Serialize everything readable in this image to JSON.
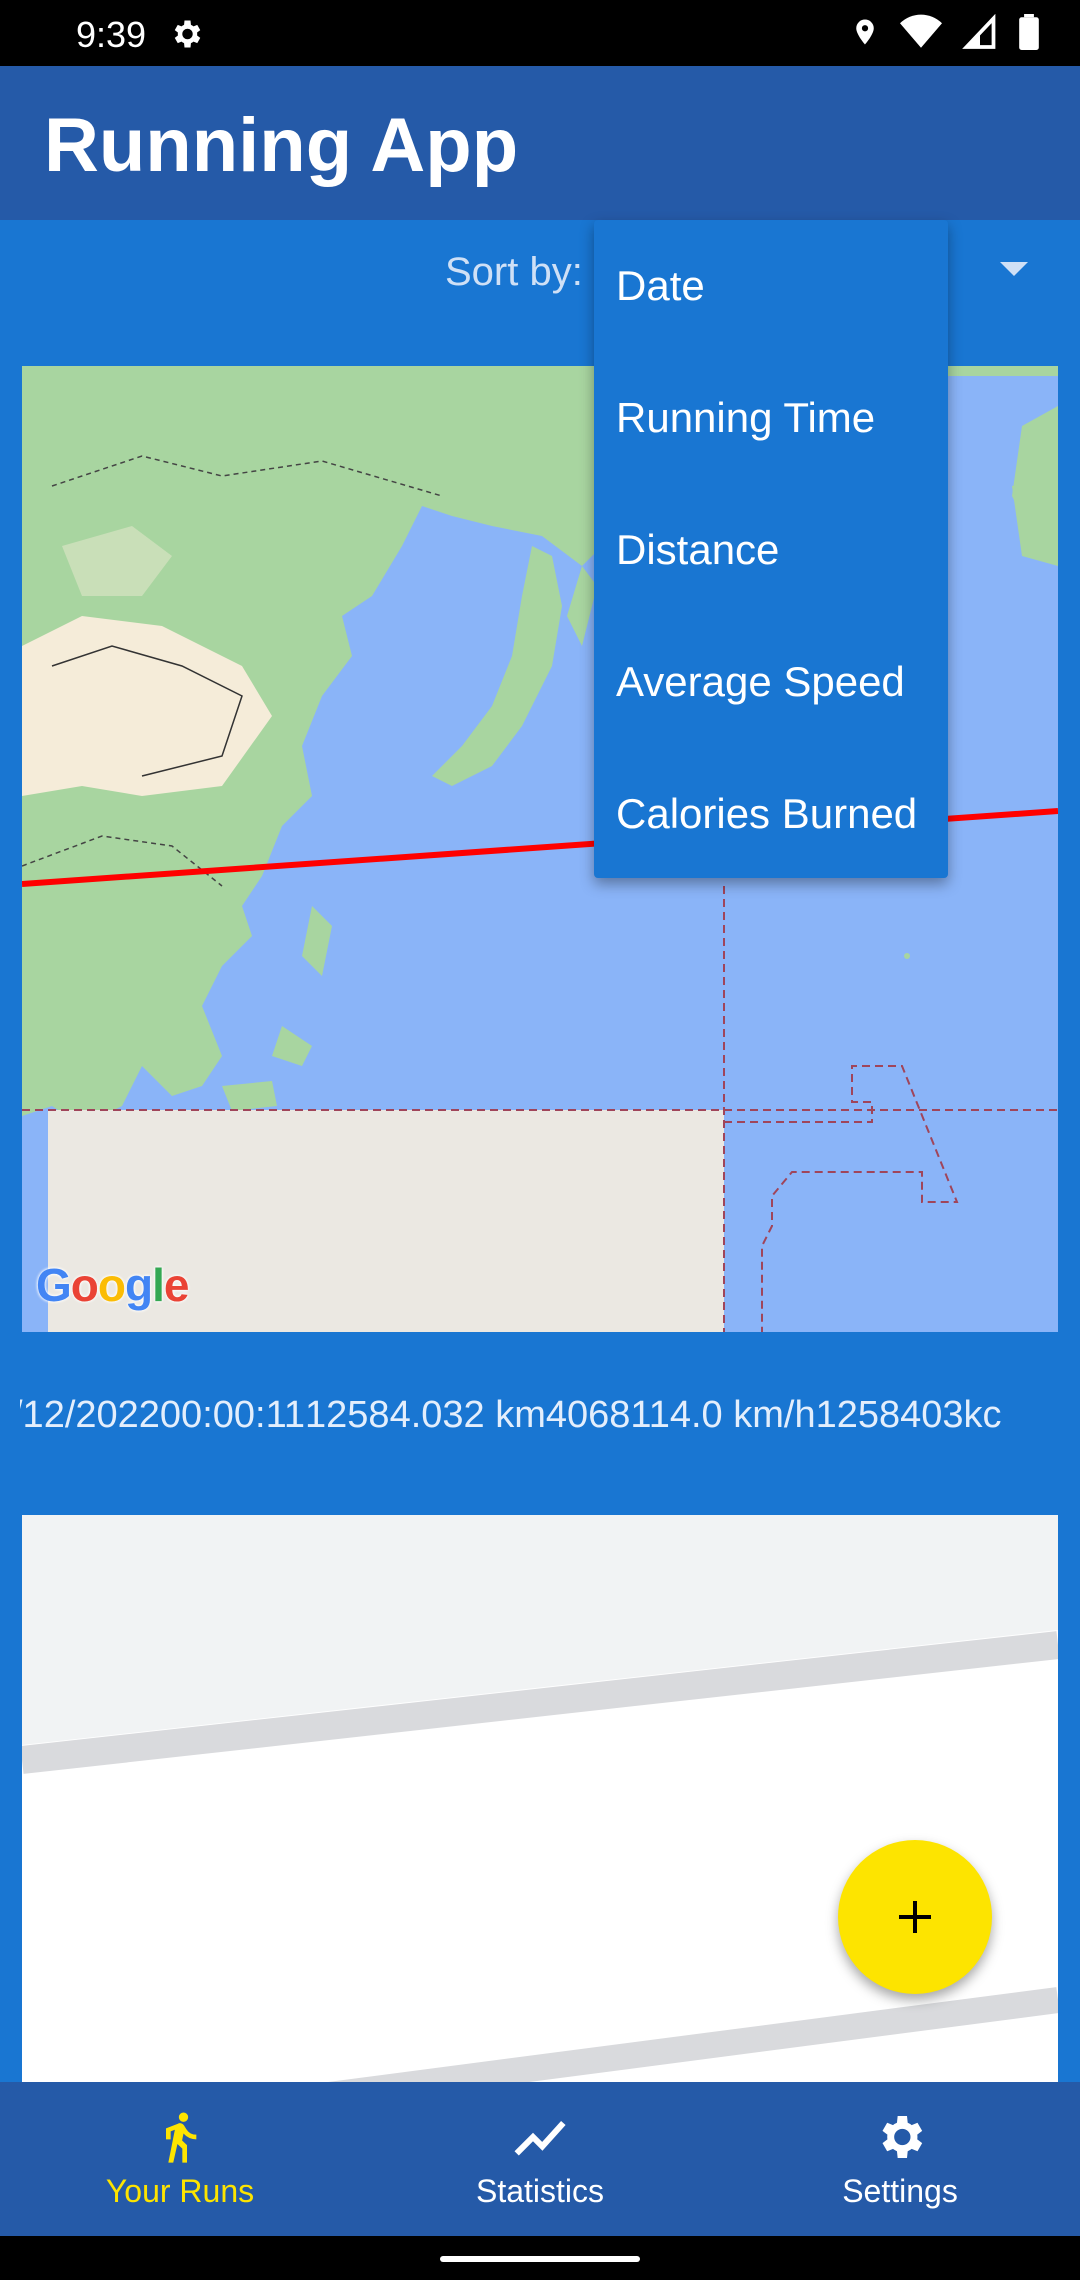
{
  "status_bar": {
    "time": "9:39"
  },
  "app_bar": {
    "title": "Running App"
  },
  "sort": {
    "label": "Sort by:",
    "options": [
      "Date",
      "Running Time",
      "Distance",
      "Average Speed",
      "Calories Burned"
    ]
  },
  "map": {
    "attribution": "Google"
  },
  "run_item": {
    "date": "/12/2022",
    "time": "00:00:11",
    "distance": "12584.032 km",
    "avg_speed": "4068114.0 km/h",
    "calories": "1258403kc"
  },
  "bottom_nav": {
    "items": [
      {
        "label": "Your Runs",
        "icon": "runner-icon",
        "active": true
      },
      {
        "label": "Statistics",
        "icon": "chart-line-icon",
        "active": false
      },
      {
        "label": "Settings",
        "icon": "gear-icon",
        "active": false
      }
    ]
  },
  "colors": {
    "primary": "#1976d2",
    "app_bar": "#255aa8",
    "accent": "#fde400",
    "route": "#ff0000"
  }
}
